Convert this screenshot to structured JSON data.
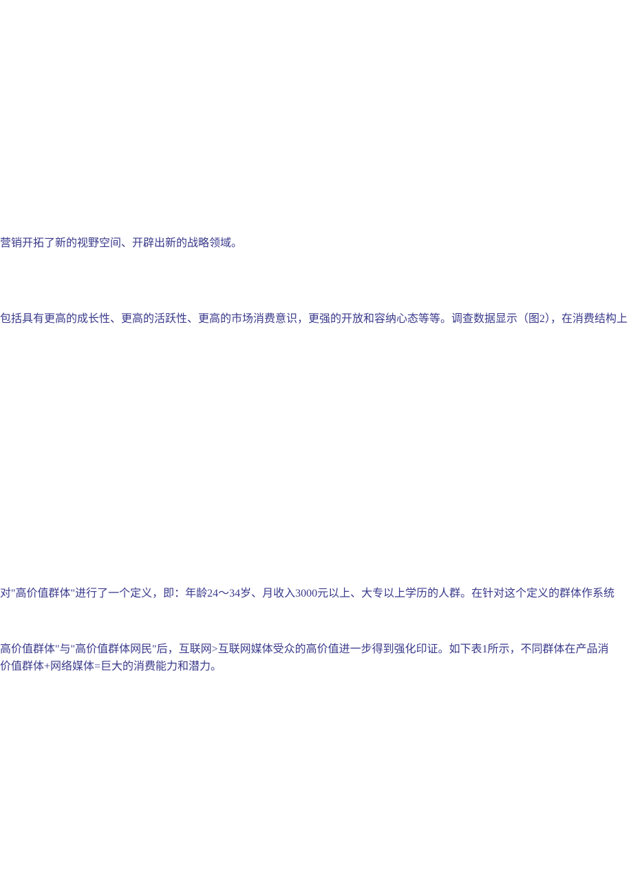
{
  "paragraphs": {
    "p1": "营销开拓了新的视野空间、开辟出新的战略领域。",
    "p2": "包括具有更高的成长性、更高的活跃性、更高的市场消费意识，更强的开放和容纳心态等等。调查数据显示（图2），在消费结构上",
    "p3": "对\"高价值群体\"进行了一个定义，即：年龄24～34岁、月收入3000元以上、大专以上学历的人群。在针对这个定义的群体作系统",
    "p4": "高价值群体\"与\"高价值群体网民\"后，互联网>互联网媒体受众的高价值进一步得到强化印证。如下表1所示，不同群体在产品消",
    "p5": "价值群体+网络媒体=巨大的消费能力和潜力。"
  }
}
